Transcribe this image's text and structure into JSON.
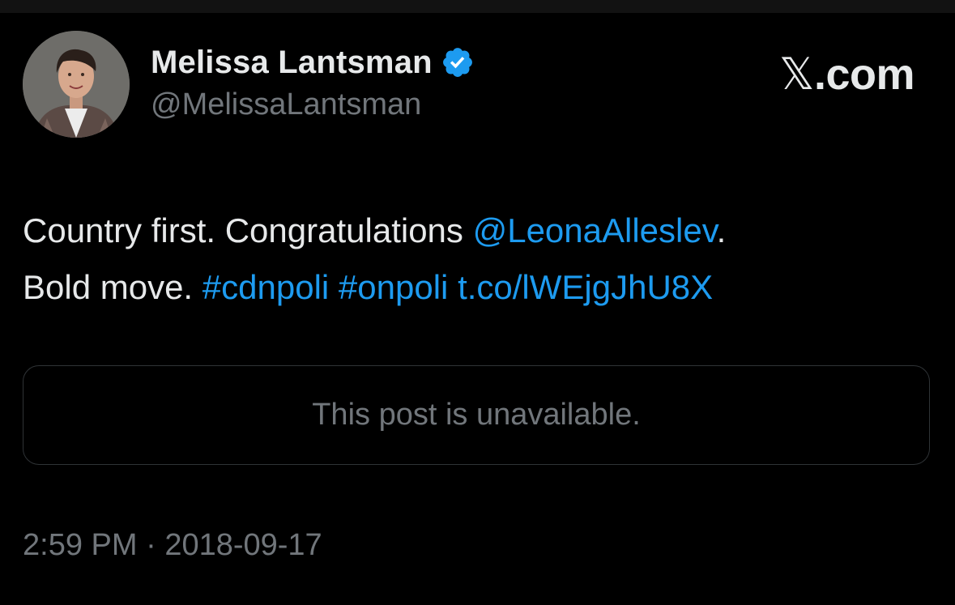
{
  "brand": {
    "x_symbol": "𝕏",
    "suffix": ".com"
  },
  "author": {
    "display_name": "Melissa Lantsman",
    "handle": "@MelissaLantsman",
    "verified": true,
    "verified_color": "#1d9bf0"
  },
  "tweet": {
    "text_part1": "Country first. Congratulations ",
    "mention": "@LeonaAlleslev",
    "text_part2": ".",
    "text_part3": "Bold move. ",
    "hashtag1": "#cdnpoli",
    "hashtag2": "#onpoli",
    "link": "t.co/lWEjgJhU8X",
    "link_color": "#1d9bf0"
  },
  "quoted_post": {
    "message": "This post is unavailable."
  },
  "timestamp": {
    "time": "2:59 PM",
    "separator": " · ",
    "date": "2018-09-17"
  },
  "colors": {
    "background": "#000000",
    "primary_text": "#e7e9ea",
    "secondary_text": "#71767b"
  }
}
